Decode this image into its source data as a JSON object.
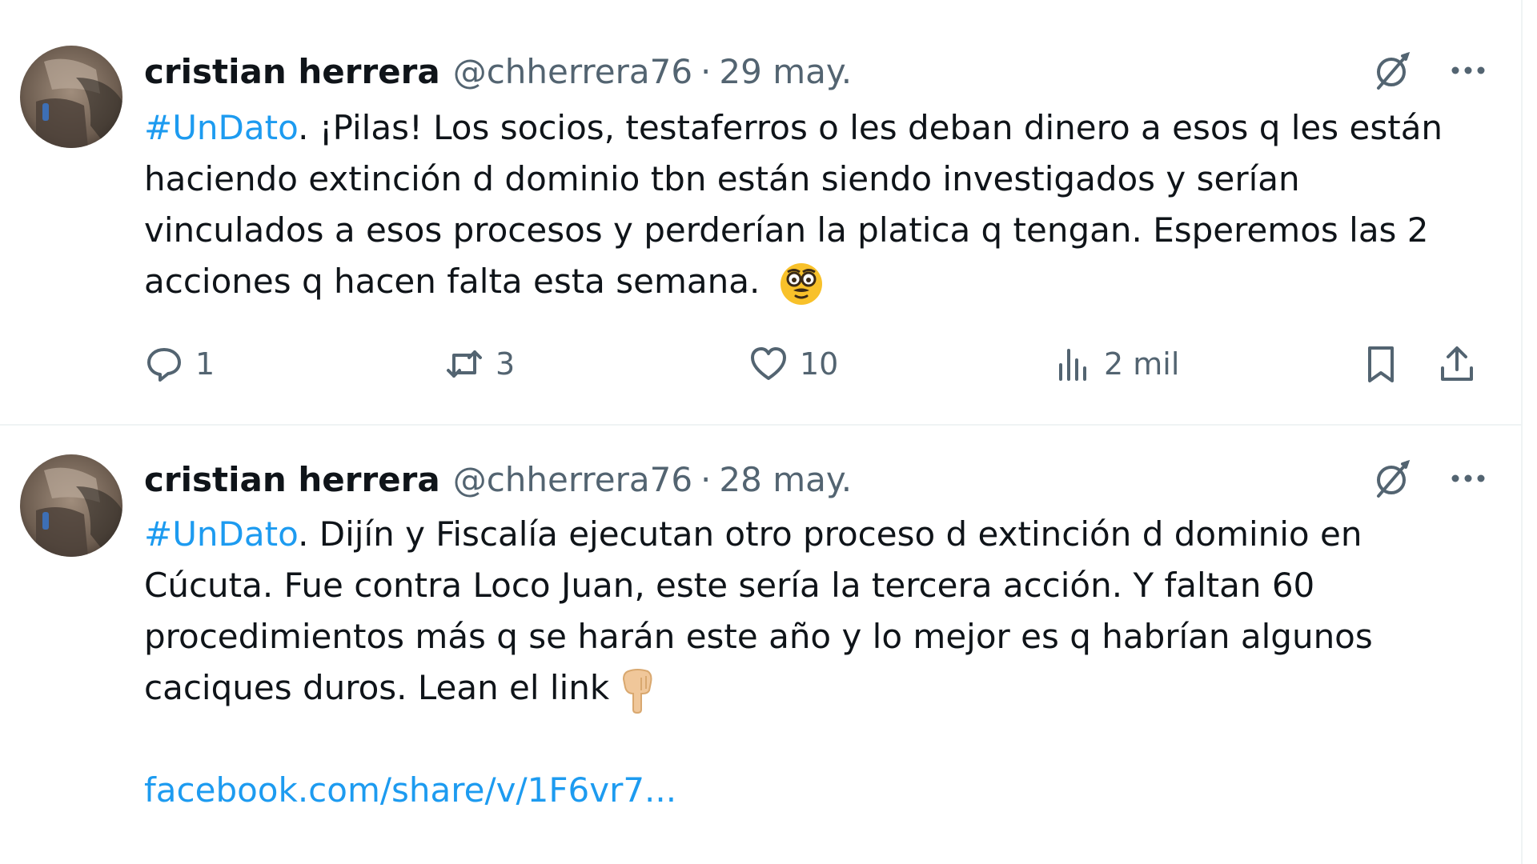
{
  "tweets": [
    {
      "author_name": "cristian herrera",
      "handle": "@chherrera76",
      "separator": "·",
      "date": "29 may.",
      "hashtag": "#UnDato",
      "text": ". ¡Pilas! Los socios, testaferros o les deban dinero a esos q les están haciendo extinción d dominio tbn están siendo investigados y serían vinculados a esos procesos y perderían la platica q tengan. Esperemos las 2 acciones q hacen falta esta semana.",
      "emoji": "disguised-face-emoji",
      "stats": {
        "replies": "1",
        "retweets": "3",
        "likes": "10",
        "views": "2 mil"
      }
    },
    {
      "author_name": "cristian herrera",
      "handle": "@chherrera76",
      "separator": "·",
      "date": "28 may.",
      "hashtag": "#UnDato",
      "text": ". Dijín y Fiscalía ejecutan otro proceso d extinción d dominio en Cúcuta. Fue contra Loco Juan, este sería la tercera acción. Y faltan 60 procedimientos más q se harán este año y lo mejor es q habrían algunos caciques duros. Lean el link",
      "emoji": "backhand-index-pointing-down-emoji",
      "link": "facebook.com/share/v/1F6vr7..."
    }
  ],
  "icons": {
    "grok": "grok-icon",
    "more": "more-options-icon",
    "reply": "reply-icon",
    "retweet": "retweet-icon",
    "like": "heart-icon",
    "views": "views-chart-icon",
    "bookmark": "bookmark-icon",
    "share": "share-icon"
  },
  "colors": {
    "link": "#1d9bf0",
    "text": "#0f1419",
    "secondary": "#536471",
    "divider": "#eff3f4"
  }
}
